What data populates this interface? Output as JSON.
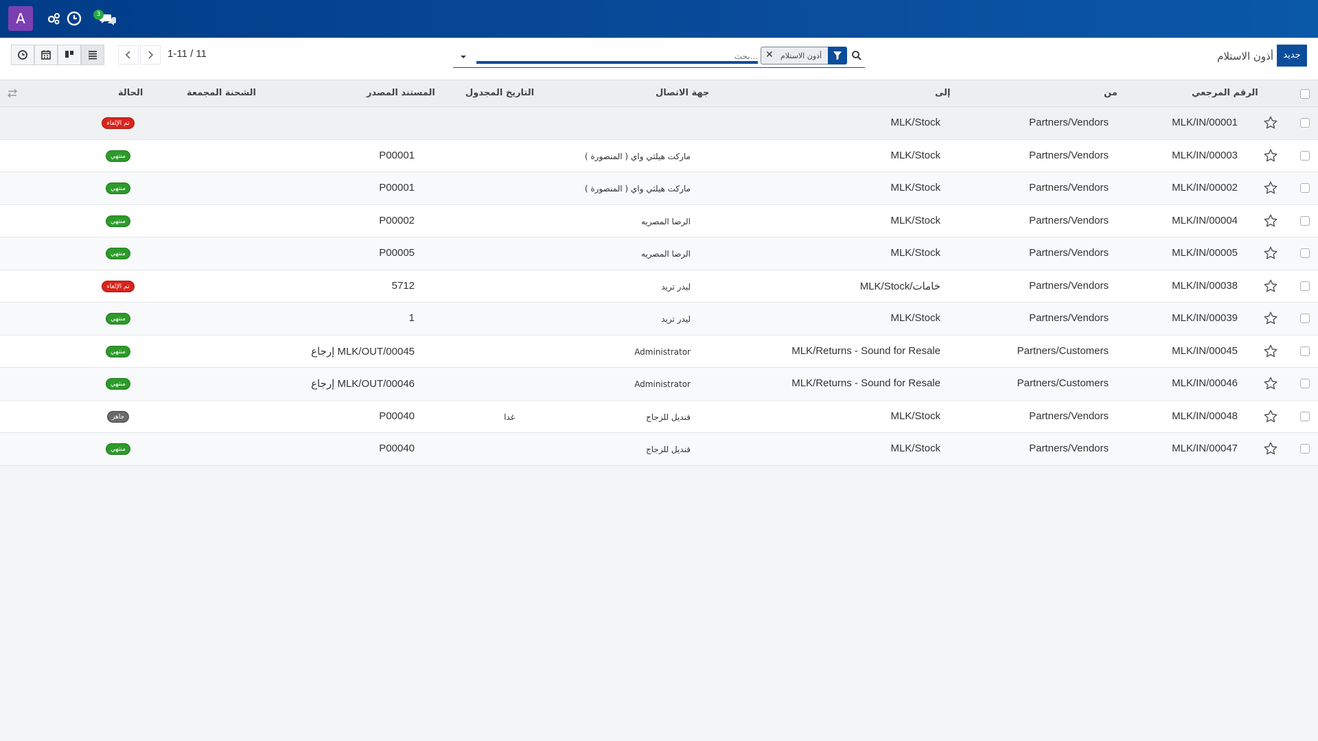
{
  "navbar": {
    "avatar_letter": "A",
    "messages_count": "3",
    "colors": {
      "bar": "#0a4d9c",
      "avatar": "#7b3fb1",
      "badge": "#28a745"
    }
  },
  "control": {
    "breadcrumb": "أذون الاستلام",
    "new_label": "جديد",
    "search_placeholder": "بحث...",
    "facet_label": "أذون الاستلام",
    "pager_value": "1-11 / 11",
    "view_icons": [
      "activity-icon",
      "calendar-icon",
      "kanban-icon",
      "list-icon"
    ]
  },
  "table": {
    "headers": {
      "reference": "الرقم المرجعي",
      "from": "من",
      "to": "إلى",
      "contact": "جهة الاتصال",
      "scheduled": "التاريخ المجدول",
      "source": "المستند المصدر",
      "batch": "الشحنة المجمعة",
      "status": "الحالة"
    },
    "rows": [
      {
        "ref": "MLK/IN/00001",
        "from": "Partners/Vendors",
        "to": "MLK/Stock",
        "contact": "",
        "scheduled": "",
        "source": "",
        "status": "تم الإلغاء",
        "status_kind": "cancel"
      },
      {
        "ref": "MLK/IN/00003",
        "from": "Partners/Vendors",
        "to": "MLK/Stock",
        "contact": "ماركت هيلثي واي ( المنصورة )",
        "scheduled": "",
        "source": "P00001",
        "status": "منتهي",
        "status_kind": "done"
      },
      {
        "ref": "MLK/IN/00002",
        "from": "Partners/Vendors",
        "to": "MLK/Stock",
        "contact": "ماركت هيلثي واي ( المنصورة )",
        "scheduled": "",
        "source": "P00001",
        "status": "منتهي",
        "status_kind": "done"
      },
      {
        "ref": "MLK/IN/00004",
        "from": "Partners/Vendors",
        "to": "MLK/Stock",
        "contact": "الرضا المصريه",
        "scheduled": "",
        "source": "P00002",
        "status": "منتهي",
        "status_kind": "done"
      },
      {
        "ref": "MLK/IN/00005",
        "from": "Partners/Vendors",
        "to": "MLK/Stock",
        "contact": "الرضا المصريه",
        "scheduled": "",
        "source": "P00005",
        "status": "منتهي",
        "status_kind": "done"
      },
      {
        "ref": "MLK/IN/00038",
        "from": "Partners/Vendors",
        "to": "MLK/Stock/خامات",
        "contact": "ليدر تريد",
        "scheduled": "",
        "source": "5712",
        "status": "تم الإلغاء",
        "status_kind": "cancel"
      },
      {
        "ref": "MLK/IN/00039",
        "from": "Partners/Vendors",
        "to": "MLK/Stock",
        "contact": "ليدر تريد",
        "scheduled": "",
        "source": "1",
        "status": "منتهي",
        "status_kind": "done"
      },
      {
        "ref": "MLK/IN/00045",
        "from": "Partners/Customers",
        "to": "MLK/Returns - Sound for Resale",
        "contact": "Administrator",
        "scheduled": "",
        "source": "إرجاع MLK/OUT/00045",
        "status": "منتهي",
        "status_kind": "done"
      },
      {
        "ref": "MLK/IN/00046",
        "from": "Partners/Customers",
        "to": "MLK/Returns - Sound for Resale",
        "contact": "Administrator",
        "scheduled": "",
        "source": "إرجاع MLK/OUT/00046",
        "status": "منتهي",
        "status_kind": "done"
      },
      {
        "ref": "MLK/IN/00048",
        "from": "Partners/Vendors",
        "to": "MLK/Stock",
        "contact": "قنديل للزجاج",
        "scheduled": "غدا",
        "source": "P00040",
        "status": "جاهز",
        "status_kind": "ready"
      },
      {
        "ref": "MLK/IN/00047",
        "from": "Partners/Vendors",
        "to": "MLK/Stock",
        "contact": "قنديل للزجاج",
        "scheduled": "",
        "source": "P00040",
        "status": "منتهي",
        "status_kind": "done"
      }
    ]
  }
}
